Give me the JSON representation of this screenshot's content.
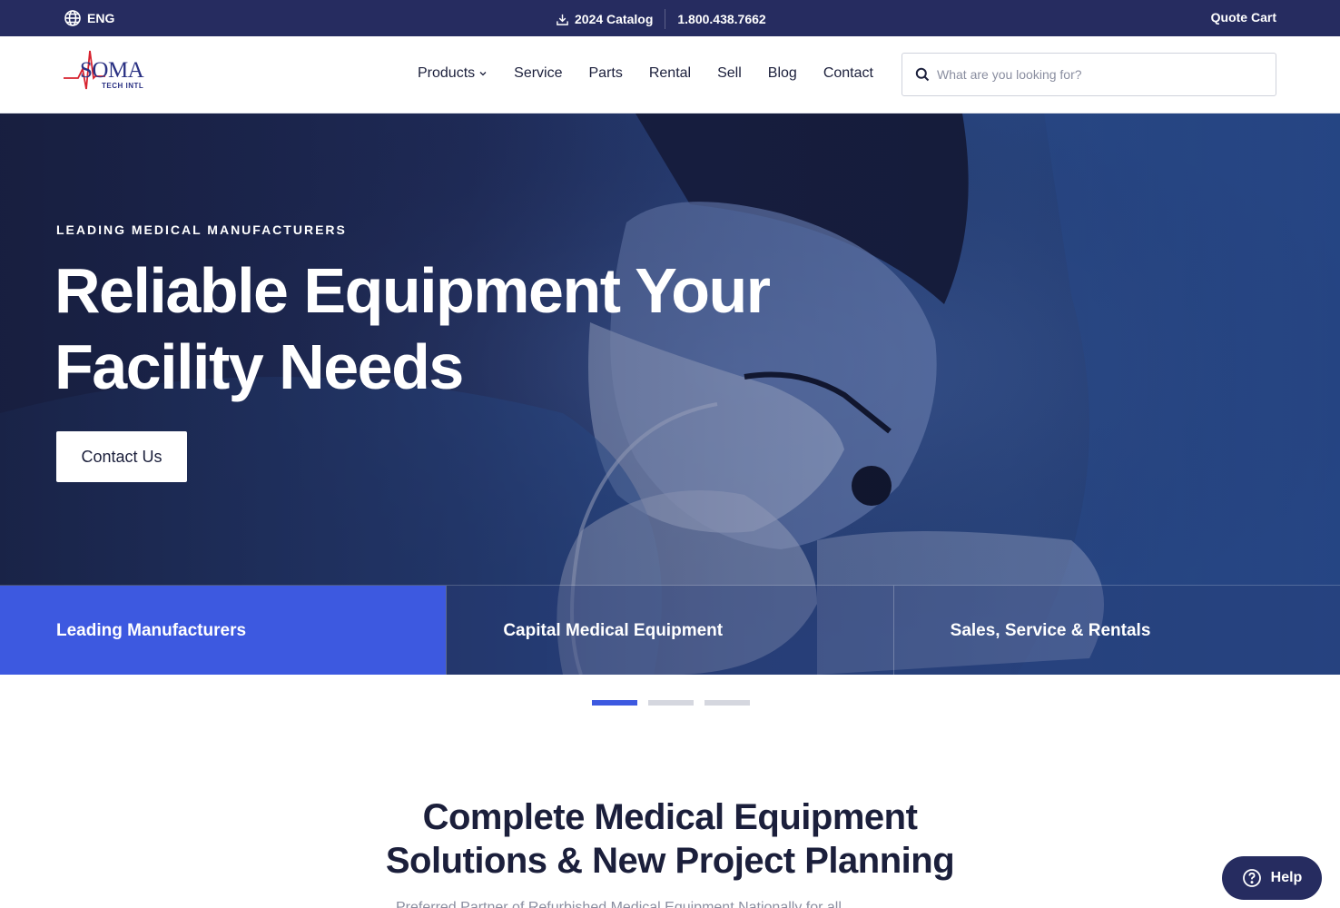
{
  "topbar": {
    "language": "ENG",
    "catalog": "2024 Catalog",
    "phone": "1.800.438.7662",
    "quote_cart": "Quote Cart"
  },
  "brand": {
    "logo_word": "SOMA",
    "logo_sub": "TECH INTL",
    "accent": "#d7232f",
    "navy": "#2a3183"
  },
  "nav": {
    "items": [
      {
        "label": "Products"
      },
      {
        "label": "Service"
      },
      {
        "label": "Parts"
      },
      {
        "label": "Rental"
      },
      {
        "label": "Sell"
      },
      {
        "label": "Blog"
      },
      {
        "label": "Contact"
      }
    ]
  },
  "search": {
    "placeholder": "What are you looking for?"
  },
  "hero": {
    "eyebrow": "LEADING MEDICAL MANUFACTURERS",
    "title_line1": "Reliable Equipment Your",
    "title_line2": "Facility Needs",
    "cta": "Contact Us",
    "tabs": [
      {
        "label": "Leading Manufacturers",
        "active": true
      },
      {
        "label": "Capital Medical Equipment",
        "active": false
      },
      {
        "label": "Sales, Service & Rentals",
        "active": false
      }
    ]
  },
  "carousel": {
    "slides": 3,
    "active_index": 0
  },
  "section": {
    "title_line1": "Complete Medical Equipment",
    "title_line2": "Solutions & New Project Planning",
    "partial_text": "Preferred Partner of Refurbished Medical Equipment Nationally for all"
  },
  "help": {
    "label": "Help"
  },
  "colors": {
    "topbar_bg": "#262c60",
    "primary_blue": "#3d59e0",
    "text_dark": "#1b1f3b"
  },
  "icons": {
    "language": "globe-icon",
    "catalog": "download-icon",
    "dropdown": "chevron-down-icon",
    "search": "search-icon",
    "help": "question-circle-icon"
  }
}
